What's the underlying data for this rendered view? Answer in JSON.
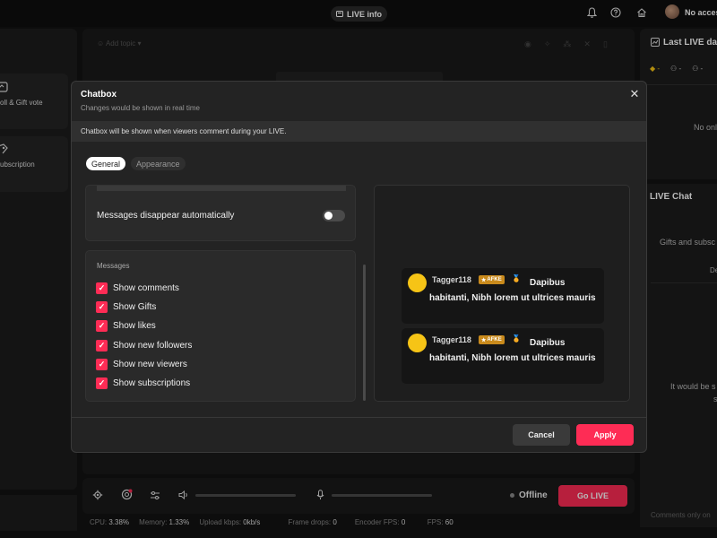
{
  "topbar": {
    "live_info": "LIVE info",
    "account": "No access"
  },
  "left_panel": {
    "items": [
      {
        "label": "oll & Gift vote"
      },
      {
        "label": "ubscription"
      }
    ]
  },
  "center": {
    "add_topic": "Add topic",
    "status": "Offline",
    "go_live": "Go LIVE",
    "stats": {
      "cpu_label": "CPU:",
      "cpu_value": "3.38%",
      "memory_label": "Memory:",
      "memory_value": "1.33%",
      "upload_label": "Upload kbps:",
      "upload_value": "0kb/s",
      "frame_drops_label": "Frame drops:",
      "frame_drops_value": "0",
      "encoder_fps_label": "Encoder FPS:",
      "encoder_fps_value": "0",
      "fps_label": "FPS:",
      "fps_value": "60"
    }
  },
  "right_panel": {
    "last_live": "Last LIVE da",
    "no_onl": "No onl",
    "live_chat": "LIVE Chat",
    "gifts_subs": "Gifts and subsc",
    "de": "De",
    "it_would": "It would be s",
    "s": "s",
    "comments_only": "Comments only on"
  },
  "modal": {
    "title": "Chatbox",
    "subtitle": "Changes would be shown in real time",
    "banner": "Chatbox will be shown when viewers comment during your LIVE.",
    "tabs": [
      {
        "label": "General",
        "active": true
      },
      {
        "label": "Appearance",
        "active": false
      }
    ],
    "auto_disappear_label": "Messages disappear automatically",
    "auto_disappear_on": false,
    "messages_header": "Messages",
    "options": [
      {
        "label": "Show comments",
        "checked": true
      },
      {
        "label": "Show Gifts",
        "checked": true
      },
      {
        "label": "Show likes",
        "checked": true
      },
      {
        "label": "Show new followers",
        "checked": true
      },
      {
        "label": "Show new viewers",
        "checked": true
      },
      {
        "label": "Show subscriptions",
        "checked": true
      }
    ],
    "preview": [
      {
        "name": "Tagger118",
        "badge": "AFKE",
        "text": "Dapibus habitanti, Nibh lorem ut ultrices mauris"
      },
      {
        "name": "Tagger118",
        "badge": "AFKE",
        "text": "Dapibus habitanti, Nibh lorem ut ultrices mauris"
      }
    ],
    "cancel": "Cancel",
    "apply": "Apply"
  },
  "colors": {
    "accent": "#fe2c55",
    "avatar_yellow": "#f6c416",
    "badge_gold": "#c98a1c"
  }
}
